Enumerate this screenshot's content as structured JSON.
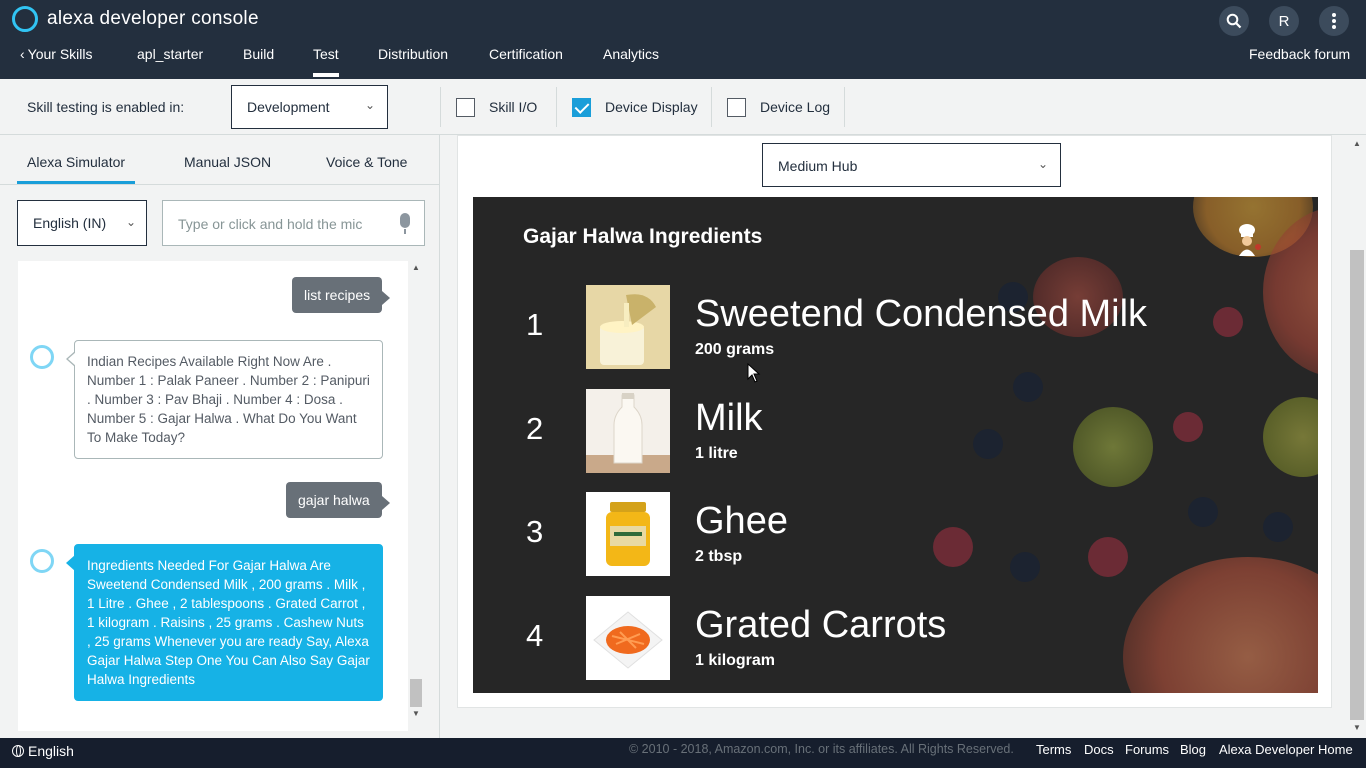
{
  "header": {
    "app_title": "alexa developer console",
    "avatar_initial": "R",
    "nav": {
      "back": "Your Skills",
      "skill_name": "apl_starter",
      "build": "Build",
      "test": "Test",
      "distribution": "Distribution",
      "certification": "Certification",
      "analytics": "Analytics",
      "feedback": "Feedback forum"
    }
  },
  "toolbar": {
    "testing_label": "Skill testing is enabled in:",
    "stage_value": "Development",
    "checkboxes": [
      {
        "label": "Skill I/O",
        "checked": false
      },
      {
        "label": "Device Display",
        "checked": true
      },
      {
        "label": "Device Log",
        "checked": false
      }
    ]
  },
  "simulator": {
    "tabs": [
      "Alexa Simulator",
      "Manual JSON",
      "Voice & Tone"
    ],
    "active_tab": "Alexa Simulator",
    "locale": "English (IN)",
    "input_placeholder": "Type or click and hold the mic",
    "messages": [
      {
        "from": "user",
        "text": "list recipes"
      },
      {
        "from": "alexa",
        "text": "Indian Recipes Available Right Now Are . Number 1 : Palak Paneer . Number 2 : Panipuri . Number 3 : Pav Bhaji . Number 4 : Dosa . Number 5 : Gajar Halwa . What Do You Want To Make Today?"
      },
      {
        "from": "user",
        "text": "gajar halwa"
      },
      {
        "from": "alexa",
        "text": "Ingredients Needed For Gajar Halwa Are Sweetend Condensed Milk , 200 grams . Milk , 1 Litre . Ghee , 2 tablespoons . Grated Carrot , 1 kilogram . Raisins , 25 grams . Cashew Nuts , 25 grams Whenever you are ready Say, Alexa Gajar Halwa Step One You Can Also Say Gajar Halwa Ingredients"
      }
    ]
  },
  "device": {
    "selected": "Medium Hub",
    "display": {
      "title": "Gajar Halwa Ingredients",
      "items": [
        {
          "num": "1",
          "name": "Sweetend Condensed Milk",
          "qty": "200 grams",
          "image": "condensed-milk"
        },
        {
          "num": "2",
          "name": "Milk",
          "qty": "1 litre",
          "image": "milk-bottle"
        },
        {
          "num": "3",
          "name": "Ghee",
          "qty": "2 tbsp",
          "image": "ghee-jar"
        },
        {
          "num": "4",
          "name": "Grated Carrots",
          "qty": "1 kilogram",
          "image": "grated-carrots"
        }
      ]
    }
  },
  "footer": {
    "language": "English",
    "copyright": "© 2010 - 2018, Amazon.com, Inc. or its affiliates. All Rights Reserved.",
    "links": [
      "Terms",
      "Docs",
      "Forums",
      "Blog",
      "Alexa Developer Home"
    ]
  },
  "colors": {
    "header_bg": "#232f3e",
    "accent": "#1a9ed9",
    "alexa_bubble": "#16b2e6",
    "user_bubble": "#687078",
    "display_bg": "#262626"
  }
}
